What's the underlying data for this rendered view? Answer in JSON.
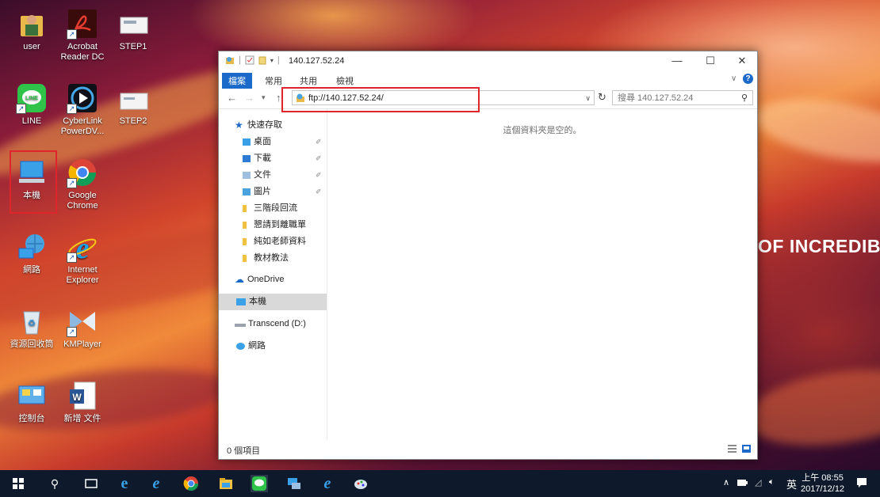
{
  "wallpaper": {
    "text": "OF INCREDIBLE"
  },
  "desktop_icons": [
    {
      "label": "user",
      "icon": "user-folder-icon"
    },
    {
      "label": "Acrobat Reader DC",
      "icon": "acrobat-icon"
    },
    {
      "label": "STEP1",
      "icon": "image-file-icon"
    },
    {
      "label": "LINE",
      "icon": "line-app-icon"
    },
    {
      "label": "CyberLink PowerDV...",
      "icon": "powerdvd-icon"
    },
    {
      "label": "STEP2",
      "icon": "image-file-icon"
    },
    {
      "label": "本機",
      "icon": "this-pc-icon"
    },
    {
      "label": "Google Chrome",
      "icon": "chrome-icon"
    },
    {
      "label": "網路",
      "icon": "network-icon"
    },
    {
      "label": "Internet Explorer",
      "icon": "ie-icon"
    },
    {
      "label": "資源回收筒",
      "icon": "recycle-bin-icon"
    },
    {
      "label": "KMPlayer",
      "icon": "kmplayer-icon"
    },
    {
      "label": "控制台",
      "icon": "control-panel-icon"
    },
    {
      "label": "新增 文件",
      "icon": "word-doc-icon"
    }
  ],
  "window": {
    "title": "140.127.52.24",
    "controls": {
      "minimize": "—",
      "maximize": "☐",
      "close": "✕"
    },
    "ribbon_tabs": [
      "檔案",
      "常用",
      "共用",
      "檢視"
    ],
    "address": "ftp://140.127.52.24/",
    "search_placeholder": "搜尋 140.127.52.24",
    "empty_message": "這個資料夾是空的。",
    "status": "0 個項目"
  },
  "nav": {
    "quick_access": "快速存取",
    "items": [
      {
        "label": "桌面",
        "pinned": true
      },
      {
        "label": "下載",
        "pinned": true
      },
      {
        "label": "文件",
        "pinned": true
      },
      {
        "label": "圖片",
        "pinned": true
      },
      {
        "label": "三階段回流",
        "pinned": false
      },
      {
        "label": "懇請到離職單",
        "pinned": false
      },
      {
        "label": "純如老師資料",
        "pinned": false
      },
      {
        "label": "教材教法",
        "pinned": false
      }
    ],
    "onedrive": "OneDrive",
    "this_pc": "本機",
    "drive": "Transcend (D:)",
    "network": "網路",
    "pin_glyph": "✐"
  },
  "taskbar": {
    "ime": "英",
    "clock_time": "上午 08:55",
    "clock_date": "2017/12/12"
  },
  "colors": {
    "file_tab": "#1b6ac9",
    "highlight_box": "#e0242b",
    "taskbar": "#0e1a2c"
  }
}
